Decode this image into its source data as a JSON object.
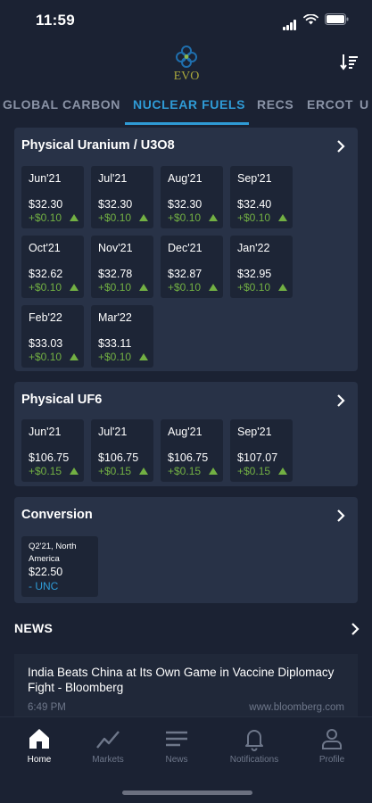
{
  "status_bar": {
    "time": "11:59"
  },
  "header": {
    "logo_text": "EVO"
  },
  "colors": {
    "accent": "#2f9bd6",
    "positive": "#72b043",
    "background": "#1b2233",
    "card": "#283247",
    "tile": "#1d2536",
    "logo": "#a8a63c"
  },
  "tabs": [
    {
      "label": "GLOBAL CARBON",
      "active": false
    },
    {
      "label": "NUCLEAR FUELS",
      "active": true
    },
    {
      "label": "RECS",
      "active": false
    },
    {
      "label": "ERCOT",
      "active": false
    },
    {
      "label": "U",
      "active": false
    }
  ],
  "uranium": {
    "title": "Physical Uranium / U3O8",
    "tiles": [
      {
        "month": "Jun'21",
        "price": "$32.30",
        "change": "+$0.10"
      },
      {
        "month": "Jul'21",
        "price": "$32.30",
        "change": "+$0.10"
      },
      {
        "month": "Aug'21",
        "price": "$32.30",
        "change": "+$0.10"
      },
      {
        "month": "Sep'21",
        "price": "$32.40",
        "change": "+$0.10"
      },
      {
        "month": "Oct'21",
        "price": "$32.62",
        "change": "+$0.10"
      },
      {
        "month": "Nov'21",
        "price": "$32.78",
        "change": "+$0.10"
      },
      {
        "month": "Dec'21",
        "price": "$32.87",
        "change": "+$0.10"
      },
      {
        "month": "Jan'22",
        "price": "$32.95",
        "change": "+$0.10"
      },
      {
        "month": "Feb'22",
        "price": "$33.03",
        "change": "+$0.10"
      },
      {
        "month": "Mar'22",
        "price": "$33.11",
        "change": "+$0.10"
      }
    ]
  },
  "uf6": {
    "title": "Physical UF6",
    "tiles": [
      {
        "month": "Jun'21",
        "price": "$106.75",
        "change": "+$0.15"
      },
      {
        "month": "Jul'21",
        "price": "$106.75",
        "change": "+$0.15"
      },
      {
        "month": "Aug'21",
        "price": "$106.75",
        "change": "+$0.15"
      },
      {
        "month": "Sep'21",
        "price": "$107.07",
        "change": "+$0.15"
      }
    ]
  },
  "conversion": {
    "title": "Conversion",
    "tile": {
      "label": "Q2'21, North America",
      "price": "$22.50",
      "unit": "- UNC"
    }
  },
  "news": {
    "heading": "NEWS",
    "items": [
      {
        "title": "India Beats China at Its Own Game in Vaccine Diplomacy Fight - Bloomberg",
        "time": "6:49 PM",
        "source": "www.bloomberg.com"
      }
    ]
  },
  "tabbar": [
    {
      "label": "Home",
      "icon": "home-icon",
      "active": true
    },
    {
      "label": "Markets",
      "icon": "chart-line-icon",
      "active": false
    },
    {
      "label": "News",
      "icon": "news-lines-icon",
      "active": false
    },
    {
      "label": "Notifications",
      "icon": "bell-icon",
      "active": false
    },
    {
      "label": "Profile",
      "icon": "person-icon",
      "active": false
    }
  ]
}
